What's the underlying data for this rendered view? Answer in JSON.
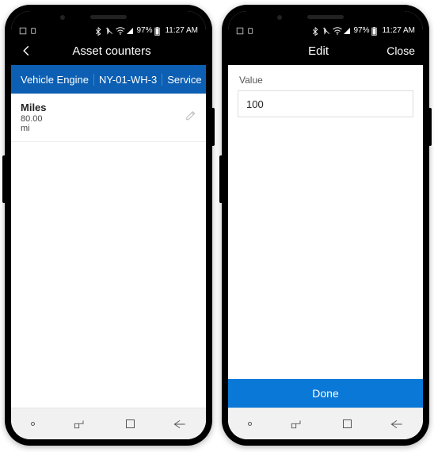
{
  "statusbar": {
    "battery_pct": "97%",
    "time": "11:27 AM"
  },
  "left_phone": {
    "appbar_title": "Asset counters",
    "bluebar": {
      "asset_type": "Vehicle Engine",
      "asset_id": "NY-01-WH-3",
      "category": "Service"
    },
    "counter": {
      "name": "Miles",
      "value": "80.00",
      "unit": "mi"
    }
  },
  "right_phone": {
    "appbar_title": "Edit",
    "close_label": "Close",
    "form": {
      "label": "Value",
      "value": "100"
    },
    "done_label": "Done"
  }
}
